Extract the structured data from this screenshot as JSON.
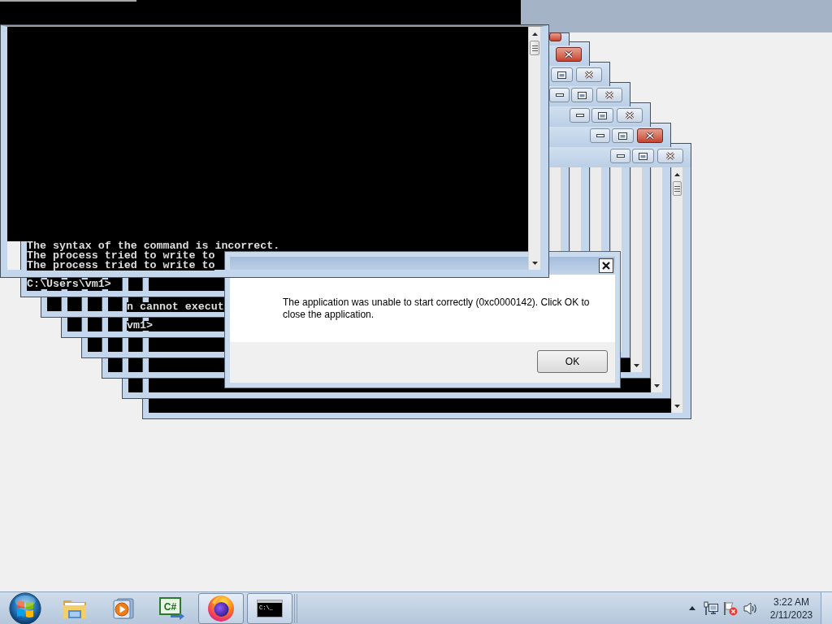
{
  "front_console": {
    "lines": [
      "The syntax of the command is incorrect.",
      "The process tried to write to",
      "The process tried to write to"
    ]
  },
  "console_windows": [
    {
      "active": true
    },
    {
      "active": true
    },
    {
      "active": false
    },
    {
      "active": false
    },
    {
      "active": false
    },
    {
      "active": true
    },
    {
      "active": false
    }
  ],
  "console_fragments": [
    "C:\\Users\\vm1>",
    "n cannot execut",
    "vm1>"
  ],
  "dialog": {
    "message": "The application was unable to start correctly (0xc0000142). Click OK to close the application.",
    "buttons": [
      "OK"
    ]
  },
  "taskbar": {
    "items": [
      {
        "kind": "folder",
        "running": false
      },
      {
        "kind": "media",
        "running": false
      },
      {
        "kind": "code",
        "running": false,
        "glyph": "C#"
      },
      {
        "kind": "browser",
        "running": true
      },
      {
        "kind": "console",
        "running": true,
        "glyph": "C:\\_"
      }
    ],
    "clock": {
      "time": "3:22 AM",
      "date": "2/11/2023"
    }
  }
}
